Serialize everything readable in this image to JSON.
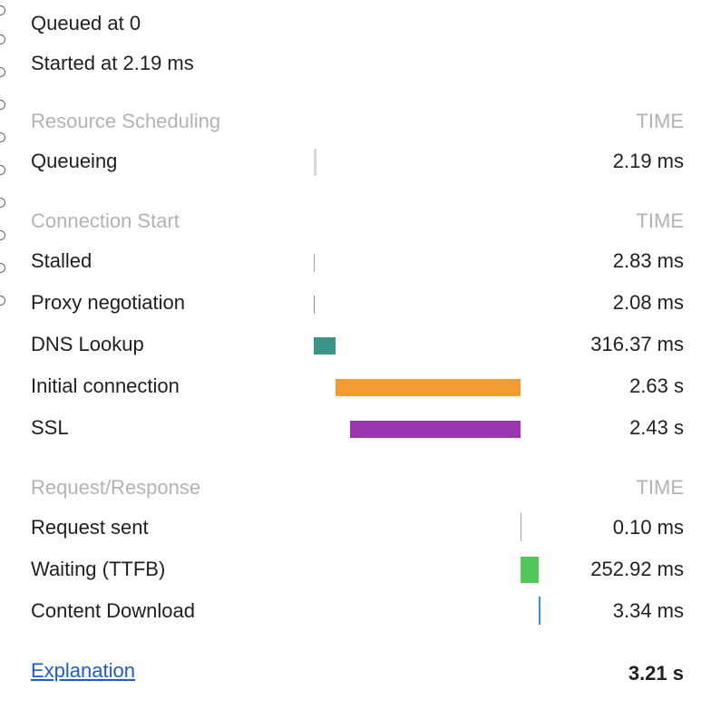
{
  "summary": {
    "queued": "Queued at 0",
    "started": "Started at 2.19 ms"
  },
  "sections": {
    "scheduling": {
      "title": "Resource Scheduling",
      "time_header": "TIME",
      "rows": [
        {
          "label": "Queueing",
          "value": "2.19 ms"
        }
      ]
    },
    "connection": {
      "title": "Connection Start",
      "time_header": "TIME",
      "rows": [
        {
          "label": "Stalled",
          "value": "2.83 ms"
        },
        {
          "label": "Proxy negotiation",
          "value": "2.08 ms"
        },
        {
          "label": "DNS Lookup",
          "value": "316.37 ms"
        },
        {
          "label": "Initial connection",
          "value": "2.63 s"
        },
        {
          "label": "SSL",
          "value": "2.43 s"
        }
      ]
    },
    "request": {
      "title": "Request/Response",
      "time_header": "TIME",
      "rows": [
        {
          "label": "Request sent",
          "value": "0.10 ms"
        },
        {
          "label": "Waiting (TTFB)",
          "value": "252.92 ms"
        },
        {
          "label": "Content Download",
          "value": "3.34 ms"
        }
      ]
    }
  },
  "footer": {
    "explanation_link": "Explanation",
    "total": "3.21 s"
  },
  "colors": {
    "queueing": "#d9d9d9",
    "stalled": "#a0a0a0",
    "proxy": "#a08c7a",
    "dns": "#3b9488",
    "initial_connection": "#f39c34",
    "ssl": "#9b35b0",
    "request_sent": "#a0a0a0",
    "waiting": "#53c75b",
    "content_download": "#3b8fe0"
  }
}
